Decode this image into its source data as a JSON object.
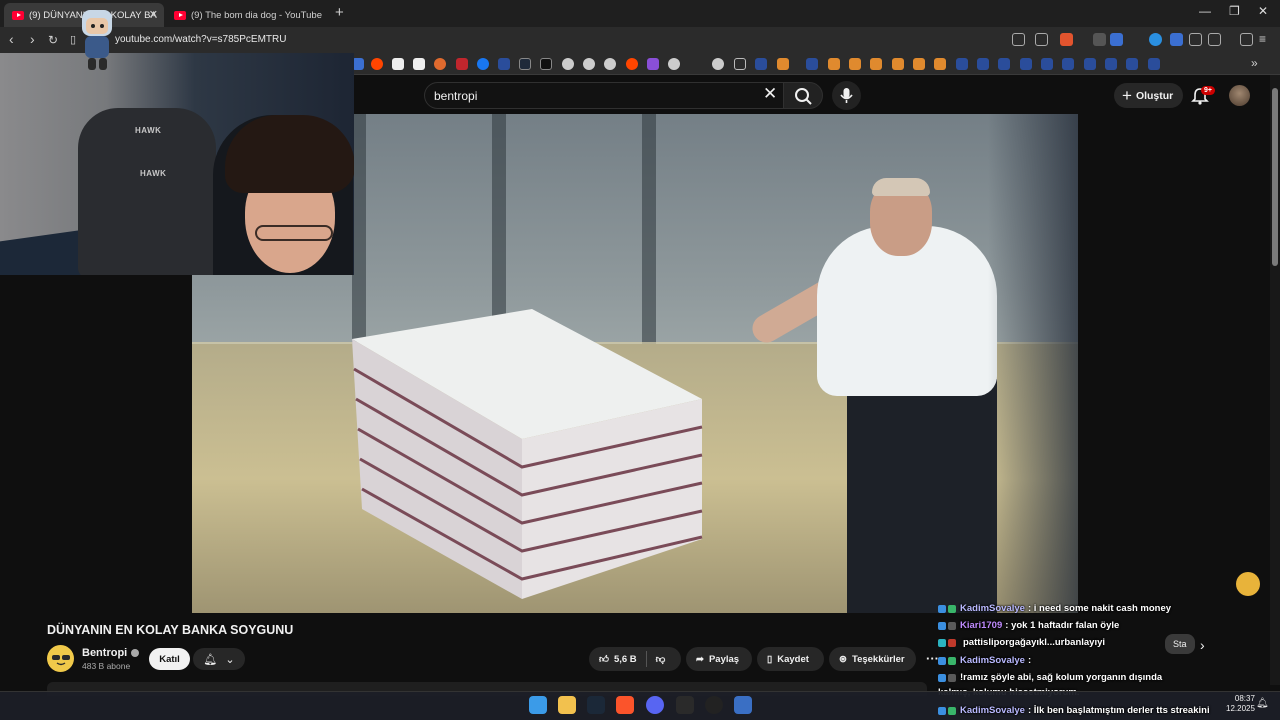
{
  "browser": {
    "tabs": [
      {
        "label": "(9) DÜNYANIN EN KOLAY BA",
        "active": true
      },
      {
        "label": "(9) The bom dia dog - YouTube",
        "active": false
      }
    ],
    "new_tab": "+",
    "url": "youtube.com/watch?v=s785PcEMTRU",
    "window_controls": {
      "minimize": "—",
      "restore": "❐",
      "close": "✕"
    }
  },
  "youtube": {
    "search": {
      "value": "bentropi",
      "clear": "✕"
    },
    "create_label": "Oluştur",
    "notifications_badge": "9+",
    "video": {
      "title": "DÜNYANIN EN KOLAY BANKA SOYGUNU",
      "channel": "Bentropi",
      "subscribers": "483 B abone",
      "join_label": "Katıl",
      "likes": "5,6 B",
      "share_label": "Paylaş",
      "save_label": "Kaydet",
      "thanks_label": "Teşekkürler",
      "more_label": "···"
    },
    "chips": [
      "Sta"
    ]
  },
  "webcam": {
    "logo_top": "HAWK",
    "logo_bottom": "HAWK"
  },
  "chat": [
    {
      "user": "KadimSovalye",
      "color": "#b9b9ff",
      "message": "i need some nakit cash money"
    },
    {
      "user": "Kiari1709",
      "color": "#c08bff",
      "message": "yok 1 haftadır falan öyle"
    },
    {
      "user": "",
      "color": "#ffffff",
      "message": "pattisliporgağayıkl...urbanlayıyi"
    },
    {
      "user": "KadimSovalye",
      "color": "#b9b9ff",
      "message": ""
    },
    {
      "user": "",
      "color": "#ffffff",
      "message": "!ramız şöyle abi, sağ kolum yorganın dışında"
    },
    {
      "user": "",
      "color": "#ffffff",
      "message": "kalmış, kolumu hissetmiyorum."
    },
    {
      "user": "KadimSovalye",
      "color": "#b9b9ff",
      "message": "İlk ben başlatmıştım derler tts streakini"
    }
  ],
  "taskbar": {
    "time": "08:37",
    "date": "12.2025"
  },
  "colors": {
    "youtube_red": "#ff0033",
    "background": "#0f0f0f",
    "chip_bg": "#272727"
  }
}
